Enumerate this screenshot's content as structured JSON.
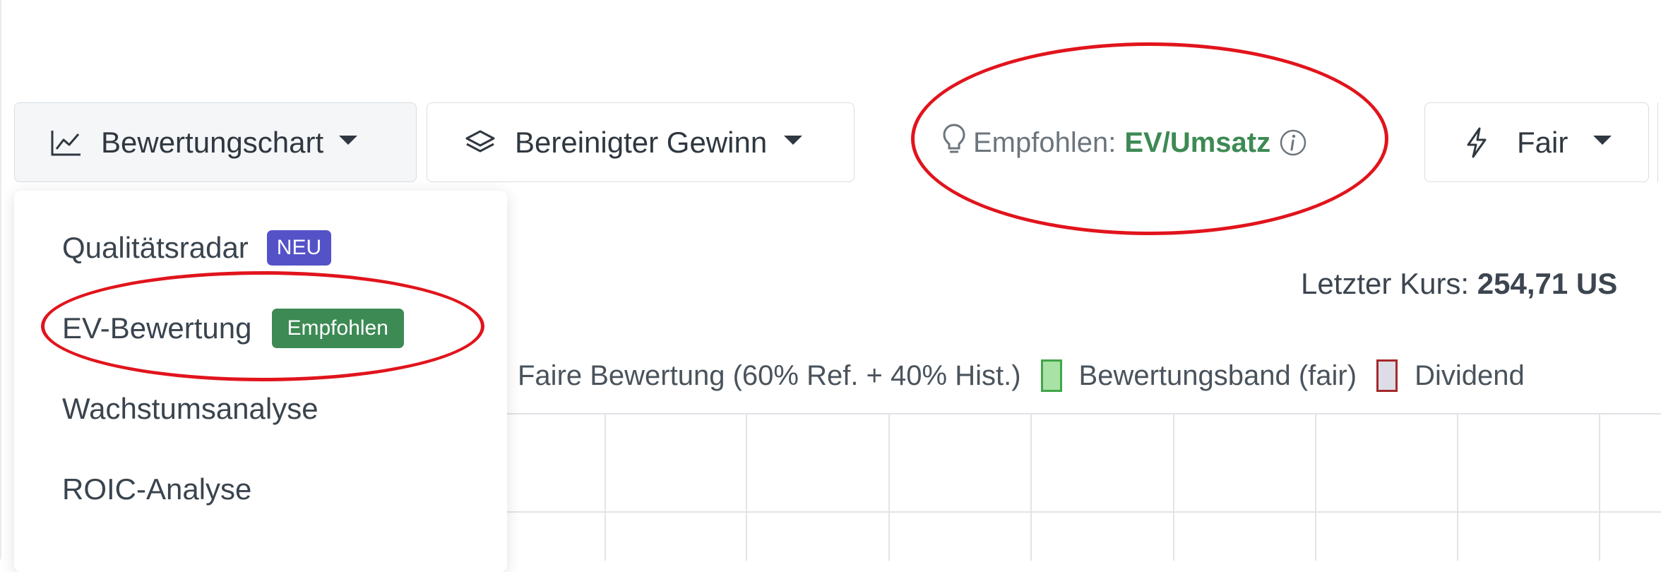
{
  "toolbar": {
    "chart_button": {
      "label": "Bewertungschart",
      "icon": "line-chart-icon"
    },
    "gewinn_button": {
      "label": "Bereinigter Gewinn",
      "icon": "layers-icon"
    },
    "recommendation": {
      "prefix": "Empfohlen:",
      "value": "EV/Umsatz",
      "icon": "lightbulb-icon",
      "info_icon": "info-icon"
    },
    "fair_button": {
      "label": "Fair",
      "icon": "lightning-icon"
    }
  },
  "menu": {
    "items": [
      {
        "label": "Qualitätsradar",
        "badge": "NEU"
      },
      {
        "label": "EV-Bewertung",
        "badge": "Empfohlen"
      },
      {
        "label": "Wachstumsanalyse"
      },
      {
        "label": "ROIC-Analyse"
      }
    ]
  },
  "price": {
    "label": "Letzter Kurs:",
    "value": "254,71 US"
  },
  "legend": {
    "items": [
      {
        "label": "Faire Bewertung (60% Ref. + 40% Hist.)"
      },
      {
        "label": "Bewertungsband (fair)",
        "color": "#a8e2a4"
      },
      {
        "label": "Dividend",
        "color": "#dddde8"
      }
    ]
  },
  "colors": {
    "accent_green": "#3d8a54",
    "badge_purple": "#5552c8",
    "annotation_red": "#e1141c"
  }
}
